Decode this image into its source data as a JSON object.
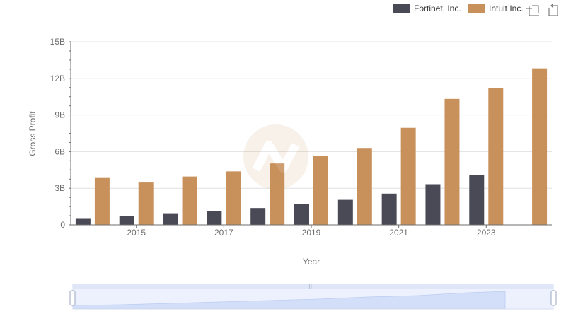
{
  "chart_data": {
    "type": "bar",
    "categories": [
      "2014",
      "2015",
      "2016",
      "2017",
      "2018",
      "2019",
      "2020",
      "2021",
      "2022",
      "2023",
      "2024"
    ],
    "x_tick_labels": [
      "2015",
      "2017",
      "2019",
      "2021",
      "2023"
    ],
    "series": [
      {
        "name": "Fortinet, Inc.",
        "color": "#4a4a56",
        "values": [
          0.55,
          0.74,
          0.95,
          1.12,
          1.38,
          1.68,
          2.05,
          2.56,
          3.33,
          4.07,
          null
        ]
      },
      {
        "name": "Intuit Inc.",
        "color": "#c8915c",
        "values": [
          3.84,
          3.47,
          3.96,
          4.38,
          5.03,
          5.62,
          6.3,
          7.95,
          10.32,
          11.23,
          12.82
        ]
      }
    ],
    "y_tick_labels": [
      "0",
      "3B",
      "6B",
      "9B",
      "12B",
      "15B"
    ],
    "ylim": [
      0,
      15
    ],
    "xlabel": "Year",
    "ylabel": "Gross Profit",
    "legend_position": "top-right",
    "grid": true
  },
  "toolbar": {
    "icons": [
      "restore-icon",
      "zoom-icon"
    ]
  },
  "datazoom": {
    "range_start": 0,
    "range_end": 100
  }
}
